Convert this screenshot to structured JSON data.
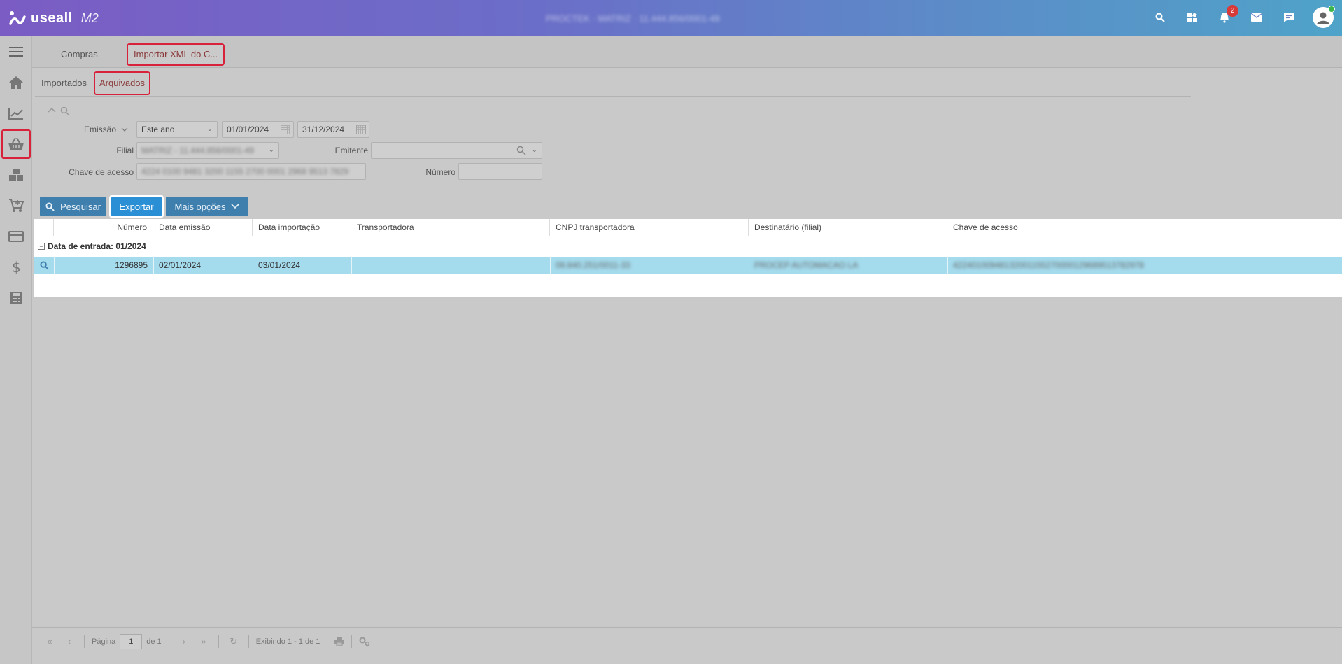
{
  "header": {
    "logo_text": "useall",
    "logo_suffix": "M2",
    "center_text": "PROCTEK · MATRIZ · 11.444.856/0001-49",
    "notification_count": "2"
  },
  "sidebar": {
    "items": [
      "home",
      "dashboard",
      "compras",
      "estoque",
      "vendas",
      "financeiro",
      "faturamento",
      "calculadora"
    ]
  },
  "tabs": {
    "compras": "Compras",
    "importar": "Importar XML do C..."
  },
  "subtabs": {
    "importados": "Importados",
    "arquivados": "Arquivados"
  },
  "filters": {
    "emissao_label": "Emissão",
    "emissao_period": "Este ano",
    "date_from": "01/01/2024",
    "date_to": "31/12/2024",
    "filial_label": "Filial",
    "filial_value": "MATRIZ - 11.444.856/0001-49",
    "emitente_label": "Emitente",
    "emitente_value": "",
    "chave_label": "Chave de acesso",
    "chave_value": "4224 0100 9481 3200 1155 2700 0001 2968 9513 7829",
    "numero_label": "Número",
    "numero_value": ""
  },
  "buttons": {
    "search": "Pesquisar",
    "export": "Exportar",
    "more": "Mais opções"
  },
  "grid": {
    "columns": [
      "Número",
      "Data emissão",
      "Data importação",
      "Transportadora",
      "CNPJ transportadora",
      "Destinatário (filial)",
      "Chave de acesso"
    ],
    "group_label": "Data de entrada: 01/2024",
    "rows": [
      {
        "numero": "1296895",
        "data_emissao": "02/01/2024",
        "data_importacao": "03/01/2024",
        "transportadora": "",
        "cnpj_transportadora": "09.840.251/0011-33",
        "destinatario": "PROCEP AUTOMACAO LA",
        "chave": "42240100948132001155270000129689513782978"
      }
    ]
  },
  "pager": {
    "page_label": "Página",
    "page_value": "1",
    "of_label": "de 1",
    "showing": "Exibindo 1 - 1 de 1"
  }
}
